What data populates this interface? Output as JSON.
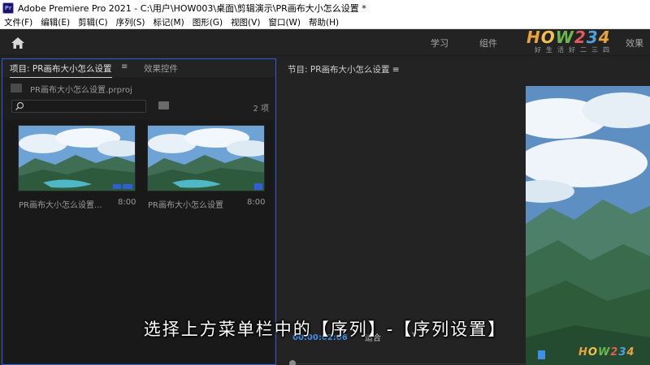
{
  "window": {
    "app_icon_text": "Pr",
    "title": "Adobe Premiere Pro 2021 - C:\\用户\\HOW003\\桌面\\剪辑演示\\PR画布大小怎么设置 *"
  },
  "menu": [
    "文件(F)",
    "编辑(E)",
    "剪辑(C)",
    "序列(S)",
    "标记(M)",
    "图形(G)",
    "视图(V)",
    "窗口(W)",
    "帮助(H)"
  ],
  "workspaces": {
    "learn": "学习",
    "assembly": "组件",
    "effects": "效果"
  },
  "watermark": {
    "logo_chars": [
      "H",
      "O",
      "W",
      "2",
      "3",
      "4"
    ],
    "subtitle": "好生活好二三四"
  },
  "project_panel": {
    "tab_label": "项目: PR画布大小怎么设置",
    "menu_glyph": "≡",
    "effects_tab_label": "效果控件",
    "project_file": "PR画布大小怎么设置.prproj",
    "search_value": "",
    "item_count": "2 项",
    "items": [
      {
        "name": "PR画布大小怎么设置...",
        "duration": "8:00"
      },
      {
        "name": "PR画布大小怎么设置",
        "duration": "8:00"
      }
    ]
  },
  "program_monitor": {
    "title": "节目: PR画布大小怎么设置",
    "menu_glyph": "≡",
    "timecode": "00:00:02:06",
    "fit_label": "适合"
  },
  "subtitle": "选择上方菜单栏中的【序列】-【序列设置】",
  "colors": {
    "panel_border": "#2f5fd6",
    "timecode": "#3f8fe8"
  }
}
